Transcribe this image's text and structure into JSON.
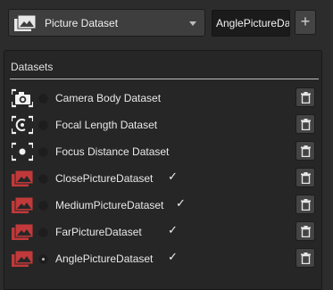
{
  "toolbar": {
    "dataset_type": "Picture Dataset",
    "dataset_type_icon": "picture-dataset-icon",
    "name_input_value": "AnglePictureDataset",
    "add_label": "+"
  },
  "panel": {
    "title": "Datasets"
  },
  "datasets": [
    {
      "label": "Camera Body Dataset",
      "icon": "camera-body-icon",
      "selected": false,
      "checked": false
    },
    {
      "label": "Focal Length Dataset",
      "icon": "focal-length-icon",
      "selected": false,
      "checked": false
    },
    {
      "label": "Focus Distance Dataset",
      "icon": "focus-distance-icon",
      "selected": false,
      "checked": false
    },
    {
      "label": "ClosePictureDataset",
      "icon": "picture-dataset-icon",
      "selected": false,
      "checked": true,
      "check_mark": "✓"
    },
    {
      "label": "MediumPictureDataset",
      "icon": "picture-dataset-icon",
      "selected": false,
      "checked": true,
      "check_mark": "✓"
    },
    {
      "label": "FarPictureDataset",
      "icon": "picture-dataset-icon",
      "selected": false,
      "checked": true,
      "check_mark": "✓"
    },
    {
      "label": "AnglePictureDataset",
      "icon": "picture-dataset-icon",
      "selected": true,
      "checked": true,
      "check_mark": "✓"
    }
  ],
  "colors": {
    "picture_icon_red": "#c1393a",
    "icon_white": "#f2f2f2",
    "background": "#2c2c2c",
    "panel": "#262626"
  }
}
